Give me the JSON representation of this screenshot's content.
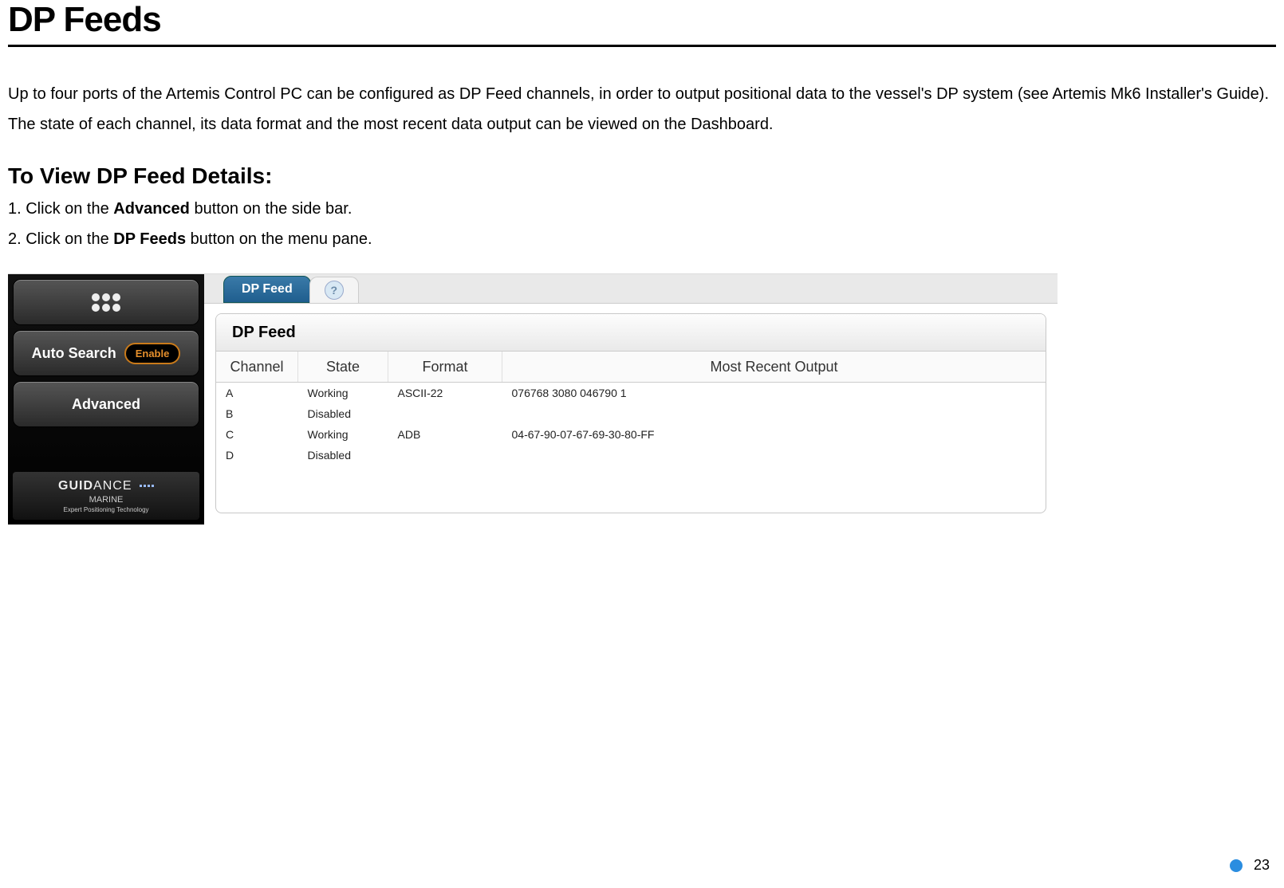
{
  "title": "DP Feeds",
  "intro_p1": "Up to four ports of the Artemis Control PC can be configured as DP Feed channels, in order to output positional data to the vessel's DP system (see Artemis Mk6 Installer's Guide).",
  "intro_p2": "The state of each channel, its data format and the most recent data output can be viewed on the Dashboard.",
  "subheading": "To View DP Feed Details:",
  "steps": {
    "s1a": "1. Click on the ",
    "s1b": "Advanced",
    "s1c": " button on the side bar.",
    "s2a": "2. Click on the ",
    "s2b": "DP Feeds",
    "s2c": " button on the menu pane."
  },
  "sidebar": {
    "auto_search": "Auto Search",
    "enable": "Enable",
    "advanced": "Advanced",
    "brand_a": "GUID",
    "brand_b": "ANCE",
    "brand_sub": "MARINE",
    "brand_tag": "Expert Positioning Technology"
  },
  "tab_label": "DP Feed",
  "help": "?",
  "card_title": "DP Feed",
  "cols": {
    "channel": "Channel",
    "state": "State",
    "format": "Format",
    "output": "Most Recent Output"
  },
  "rows": [
    {
      "channel": "A",
      "state": "Working",
      "format": "ASCII-22",
      "output": "076768 3080 046790 1"
    },
    {
      "channel": "B",
      "state": "Disabled",
      "format": "",
      "output": ""
    },
    {
      "channel": "C",
      "state": "Working",
      "format": "ADB",
      "output": "04-67-90-07-67-69-30-80-FF"
    },
    {
      "channel": "D",
      "state": "Disabled",
      "format": "",
      "output": ""
    }
  ],
  "page_number": "23"
}
